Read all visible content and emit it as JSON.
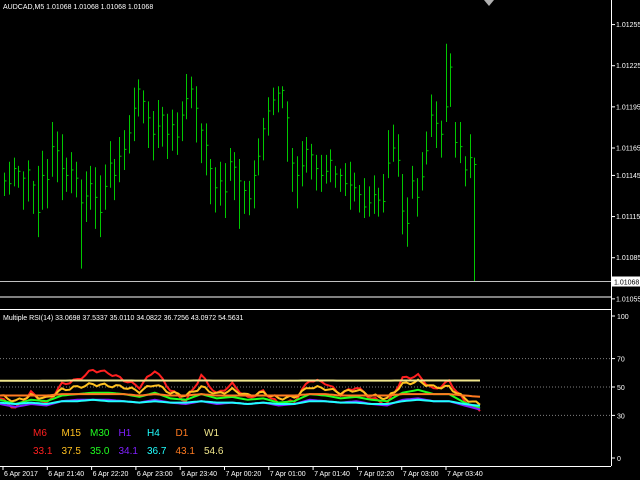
{
  "main_chart": {
    "header": "AUDCAD,M5  1.01068 1.01068 1.01068 1.01068",
    "bar_color": "#00c800",
    "price_min": 1.0106,
    "price_max": 1.0127,
    "price_labels": [
      "1.01255",
      "1.01225",
      "1.01195",
      "1.01165",
      "1.01145",
      "1.01115",
      "1.01085",
      "1.01055"
    ],
    "price_label_values": [
      1.01255,
      1.01225,
      1.01195,
      1.01165,
      1.01145,
      1.01115,
      1.01085,
      1.01055
    ],
    "current_price_label": "1.01068",
    "current_price": 1.01068,
    "bars": [
      [
        1.01141,
        1.01147,
        1.0113
      ],
      [
        1.01139,
        1.01155,
        1.01131
      ],
      [
        1.0115,
        1.01158,
        1.01137
      ],
      [
        1.01148,
        1.01152,
        1.01136
      ],
      [
        1.01143,
        1.01148,
        1.0112
      ],
      [
        1.01149,
        1.01156,
        1.01126
      ],
      [
        1.01138,
        1.01141,
        1.01117
      ],
      [
        1.01118,
        1.01152,
        1.011
      ],
      [
        1.01145,
        1.01163,
        1.0112
      ],
      [
        1.01142,
        1.01157,
        1.01121
      ],
      [
        1.01166,
        1.01184,
        1.01144
      ],
      [
        1.01163,
        1.01177,
        1.0114
      ],
      [
        1.0115,
        1.01175,
        1.01127
      ],
      [
        1.01145,
        1.01158,
        1.01133
      ],
      [
        1.01149,
        1.01162,
        1.01132
      ],
      [
        1.01143,
        1.01155,
        1.01129
      ],
      [
        1.01125,
        1.01142,
        1.01077
      ],
      [
        1.0113,
        1.01148,
        1.01111
      ],
      [
        1.01139,
        1.01152,
        1.0112
      ],
      [
        1.01129,
        1.01151,
        1.01106
      ],
      [
        1.01118,
        1.01145,
        1.011
      ],
      [
        1.01137,
        1.01153,
        1.0112
      ],
      [
        1.01154,
        1.0117,
        1.01136
      ],
      [
        1.01145,
        1.01157,
        1.01127
      ],
      [
        1.01159,
        1.01173,
        1.0114
      ],
      [
        1.01164,
        1.01178,
        1.01149
      ],
      [
        1.01176,
        1.01189,
        1.01161
      ],
      [
        1.01194,
        1.01209,
        1.0117
      ],
      [
        1.01208,
        1.01215,
        1.01188
      ],
      [
        1.01199,
        1.01207,
        1.01183
      ],
      [
        1.01187,
        1.01199,
        1.01165
      ],
      [
        1.01175,
        1.01192,
        1.01156
      ],
      [
        1.01181,
        1.012,
        1.01165
      ],
      [
        1.01189,
        1.01195,
        1.01166
      ],
      [
        1.01175,
        1.0119,
        1.01157
      ],
      [
        1.01182,
        1.01193,
        1.01163
      ],
      [
        1.01173,
        1.01191,
        1.0116
      ],
      [
        1.01189,
        1.01199,
        1.0117
      ],
      [
        1.01201,
        1.01219,
        1.01186
      ],
      [
        1.01208,
        1.01217,
        1.01194
      ],
      [
        1.01194,
        1.0121,
        1.01169
      ],
      [
        1.01178,
        1.01183,
        1.01154
      ],
      [
        1.01167,
        1.01183,
        1.01145
      ],
      [
        1.0115,
        1.01157,
        1.01124
      ],
      [
        1.01136,
        1.01151,
        1.01118
      ],
      [
        1.01141,
        1.01155,
        1.01123
      ],
      [
        1.01133,
        1.01154,
        1.01114
      ],
      [
        1.01155,
        1.01165,
        1.01141
      ],
      [
        1.01151,
        1.01162,
        1.01127
      ],
      [
        1.01141,
        1.01157,
        1.01106
      ],
      [
        1.01134,
        1.01141,
        1.01117
      ],
      [
        1.01128,
        1.01141,
        1.01116
      ],
      [
        1.01145,
        1.01156,
        1.01121
      ],
      [
        1.01159,
        1.01172,
        1.01145
      ],
      [
        1.01179,
        1.01187,
        1.01156
      ],
      [
        1.01192,
        1.01202,
        1.01174
      ],
      [
        1.012,
        1.01209,
        1.01189
      ],
      [
        1.01205,
        1.0121,
        1.01191
      ],
      [
        1.01207,
        1.0121,
        1.01194
      ],
      [
        1.01187,
        1.01199,
        1.01155
      ],
      [
        1.01154,
        1.01165,
        1.01133
      ],
      [
        1.01145,
        1.01159,
        1.01121
      ],
      [
        1.01152,
        1.0117,
        1.01137
      ],
      [
        1.01164,
        1.01173,
        1.01147
      ],
      [
        1.0116,
        1.01168,
        1.01142
      ],
      [
        1.0115,
        1.0116,
        1.01134
      ],
      [
        1.01145,
        1.0116,
        1.01133
      ],
      [
        1.01148,
        1.0116,
        1.01139
      ],
      [
        1.01156,
        1.01164,
        1.0114
      ],
      [
        1.01146,
        1.01152,
        1.01136
      ],
      [
        1.01145,
        1.0115,
        1.01133
      ],
      [
        1.01139,
        1.01154,
        1.0113
      ],
      [
        1.01138,
        1.01155,
        1.0112
      ],
      [
        1.01136,
        1.01147,
        1.01126
      ],
      [
        1.01131,
        1.01138,
        1.01118
      ],
      [
        1.01122,
        1.01143,
        1.01114
      ],
      [
        1.01125,
        1.01137,
        1.01115
      ],
      [
        1.01131,
        1.01145,
        1.01117
      ],
      [
        1.01127,
        1.01136,
        1.01115
      ],
      [
        1.01126,
        1.01146,
        1.01118
      ],
      [
        1.01154,
        1.01178,
        1.01143
      ],
      [
        1.01165,
        1.01182,
        1.01155
      ],
      [
        1.01156,
        1.01175,
        1.01144
      ],
      [
        1.01119,
        1.01146,
        1.01102
      ],
      [
        1.0111,
        1.01129,
        1.01093
      ],
      [
        1.01141,
        1.01152,
        1.01128
      ],
      [
        1.01129,
        1.01143,
        1.01115
      ],
      [
        1.01144,
        1.01162,
        1.01134
      ],
      [
        1.01163,
        1.01177,
        1.01153
      ],
      [
        1.01189,
        1.01204,
        1.01173
      ],
      [
        1.01183,
        1.01199,
        1.01165
      ],
      [
        1.01175,
        1.01185,
        1.01158
      ],
      [
        1.01195,
        1.01241,
        1.01184
      ],
      [
        1.01224,
        1.01234,
        1.01195
      ],
      [
        1.01169,
        1.01184,
        1.01158
      ],
      [
        1.01166,
        1.01184,
        1.01154
      ],
      [
        1.01149,
        1.01159,
        1.01137
      ],
      [
        1.01158,
        1.01175,
        1.01143
      ],
      [
        1.01153,
        1.01158,
        1.01068
      ]
    ]
  },
  "rsi_panel": {
    "header": "Multiple RSI(14) 33.0698 37.5337 35.0110 34.0822 36.7256 43.0972 54.5631",
    "scale_min": 0,
    "scale_max": 100,
    "scale_labels": [
      "100",
      "70",
      "50",
      "30",
      "0"
    ],
    "scale_values": [
      100,
      70,
      50,
      30,
      0
    ],
    "level_lines": [
      70,
      50,
      30
    ],
    "series": [
      {
        "name": "M6",
        "value": "33.1",
        "color": "#ff2020",
        "anchors": [
          42,
          35,
          46,
          38,
          52,
          55,
          62,
          60,
          55,
          50,
          62,
          48,
          40,
          58,
          45,
          52,
          42,
          47,
          38,
          40,
          55,
          53,
          45,
          50,
          42,
          38,
          56,
          58,
          48,
          54,
          40,
          33
        ]
      },
      {
        "name": "M15",
        "value": "37.5",
        "color": "#ffc020",
        "anchors": [
          44,
          40,
          44,
          42,
          48,
          50,
          52,
          51,
          50,
          47,
          52,
          46,
          44,
          50,
          45,
          48,
          44,
          46,
          42,
          43,
          50,
          49,
          46,
          48,
          44,
          42,
          52,
          54,
          50,
          50,
          42,
          37.5
        ]
      },
      {
        "name": "M30",
        "value": "35.0",
        "color": "#20ff20",
        "anchors": [
          41,
          38,
          41,
          40,
          44,
          45,
          46,
          46,
          45,
          43,
          46,
          42,
          41,
          45,
          42,
          43,
          41,
          42,
          39,
          40,
          45,
          44,
          42,
          43,
          41,
          40,
          46,
          48,
          45,
          45,
          39,
          35
        ]
      },
      {
        "name": "H1",
        "value": "34.1",
        "color": "#8020ff",
        "anchors": [
          38,
          36,
          38,
          37,
          40,
          41,
          41,
          41,
          40,
          39,
          41,
          39,
          38,
          40,
          38,
          39,
          38,
          39,
          37,
          38,
          41,
          40,
          39,
          40,
          38,
          37,
          41,
          42,
          40,
          40,
          37,
          34.1
        ]
      },
      {
        "name": "H4",
        "value": "36.7",
        "color": "#20ffff",
        "anchors": [
          39,
          38,
          39,
          38,
          40,
          40,
          41,
          40,
          40,
          39,
          40,
          39,
          39,
          40,
          39,
          39,
          38,
          39,
          38,
          38,
          40,
          40,
          39,
          39,
          38,
          38,
          40,
          41,
          40,
          40,
          38,
          36.7
        ]
      },
      {
        "name": "D1",
        "value": "43.1",
        "color": "#ff7a20",
        "anchors": [
          44,
          44,
          44,
          44,
          45,
          45,
          45,
          45,
          45,
          44,
          45,
          44,
          44,
          45,
          44,
          44,
          44,
          44,
          44,
          44,
          45,
          45,
          44,
          44,
          44,
          44,
          45,
          45,
          45,
          45,
          44,
          43.1
        ]
      },
      {
        "name": "W1",
        "value": "54.6",
        "color": "#f0e68c",
        "anchors": [
          54.4,
          54.4,
          54.4,
          54.5,
          54.5,
          54.6,
          54.6,
          54.6,
          54.6,
          54.5,
          54.6,
          54.5,
          54.5,
          54.6,
          54.5,
          54.5,
          54.5,
          54.5,
          54.5,
          54.5,
          54.6,
          54.6,
          54.5,
          54.5,
          54.5,
          54.5,
          54.6,
          54.6,
          54.6,
          54.6,
          54.6,
          54.6
        ]
      }
    ]
  },
  "time_axis": {
    "labels": [
      "6 Apr 2017",
      "6 Apr 21:40",
      "6 Apr 22:20",
      "6 Apr 23:00",
      "6 Apr 23:40",
      "7 Apr 00:20",
      "7 Apr 01:00",
      "7 Apr 01:40",
      "7 Apr 02:20",
      "7 Apr 03:00",
      "7 Apr 03:40"
    ]
  },
  "colors": {
    "background": "#000000",
    "grid_line": "#ffffff",
    "level_line": "#808080",
    "text": "#ffffff"
  },
  "icons": {
    "scroll_marker": "shift-triangle-icon"
  }
}
